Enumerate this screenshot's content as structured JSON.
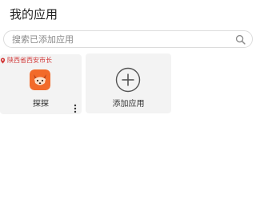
{
  "header": {
    "title": "我的应用"
  },
  "search": {
    "placeholder": "搜索已添加应用",
    "icon": "search-icon"
  },
  "location": {
    "text": "陕西省西安市长",
    "color": "#d23a3a",
    "icon": "location-pin-icon"
  },
  "apps": [
    {
      "name": "探探",
      "icon": "fox-app-icon",
      "color": "#f26b2a"
    }
  ],
  "add_app": {
    "label": "添加应用",
    "icon": "plus-circle-icon"
  }
}
